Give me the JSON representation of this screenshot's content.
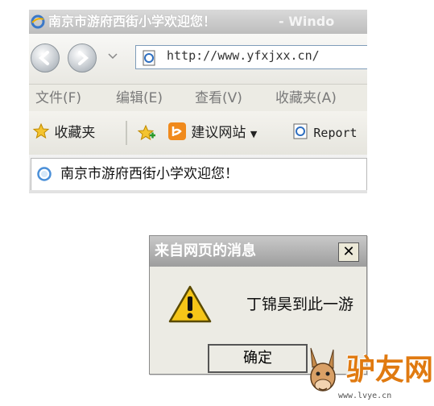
{
  "window": {
    "title": "南京市游府西街小学欢迎您！",
    "title_trunc": "- Windo"
  },
  "address": {
    "url": "http://www.yfxjxx.cn/"
  },
  "menu": [
    "文件(F)",
    "编辑(E)",
    "查看(V)",
    "收藏夹(A)"
  ],
  "favorites_bar": {
    "favorites_label": "收藏夹",
    "suggested_sites": "建议网站",
    "report": "Report"
  },
  "tab": {
    "title": "南京市游府西街小学欢迎您！"
  },
  "dialog": {
    "title": "来自网页的消息",
    "message": "丁锦昊到此一游",
    "ok_label": "确定",
    "close_glyph": "✕"
  },
  "watermark": {
    "brand": "驴友网",
    "url": "www.lvye.cn"
  },
  "colors": {
    "title_gray": "#bdbdbd",
    "dialog_bg": "#ecebe4",
    "warning_yellow": "#f5c518",
    "watermark_orange": "#e07a10"
  }
}
